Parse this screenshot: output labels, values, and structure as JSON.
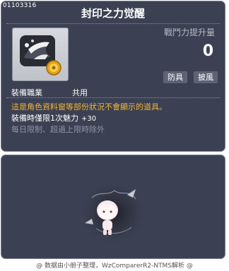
{
  "item": {
    "id": "01103316",
    "title": "封印之力觉醒",
    "icon_name": "mount-spirit-with-gold-coin-icon"
  },
  "stats": {
    "power_label": "戰鬥力提升量",
    "power_value": "0"
  },
  "tags": {
    "armor": "防具",
    "cape": "披風"
  },
  "job": {
    "label": "裝備職業",
    "value": "共用"
  },
  "description": {
    "notice": "這是角色資料窗等部份狀況不會顯示的道具。",
    "limit_label": "裝備時僅限1次魅力",
    "limit_value": "+30",
    "reset": "每日限制、超過上限時除外"
  },
  "footer": "@ 数据由小册子整理，WzComparerR2-NTMS解析 @",
  "colors": {
    "panel_bg": "#3b4152",
    "panel_border": "#7c8294",
    "notice": "#f0b33b",
    "muted": "#8f94a2"
  }
}
